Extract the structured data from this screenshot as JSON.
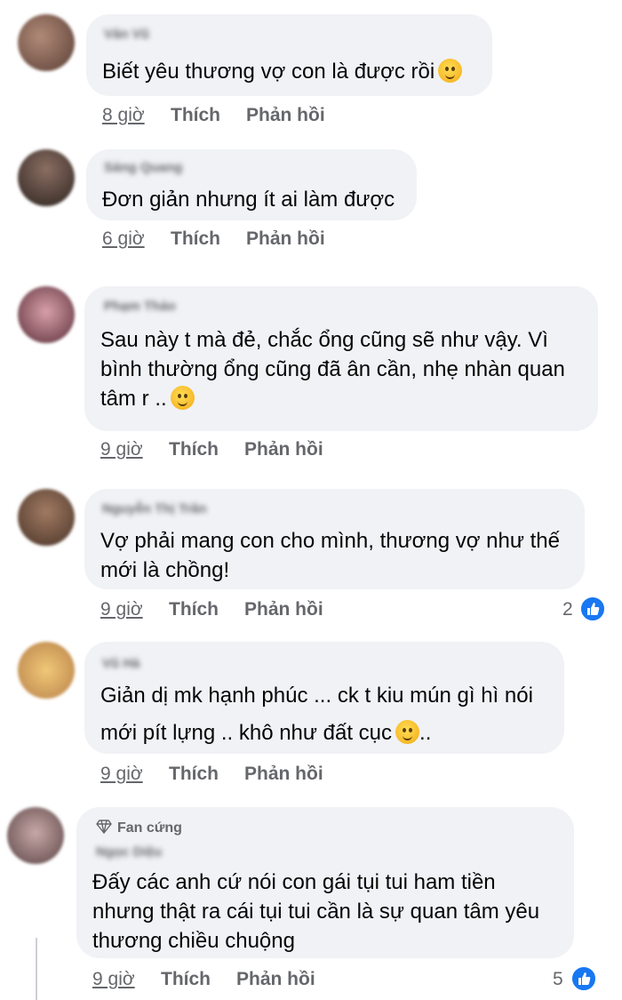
{
  "comments": [
    {
      "author": "Văn Vũ",
      "lines": [
        "Biết yêu thương vợ con là được rồi"
      ],
      "emoji": "crying-face-emoji",
      "time": "8 giờ",
      "like_label": "Thích",
      "reply_label": "Phản hồi",
      "avatar_color": "#7a5a4a"
    },
    {
      "author": "Sáng Quang",
      "lines": [
        "Đơn giản nhưng ít ai làm được"
      ],
      "time": "6 giờ",
      "like_label": "Thích",
      "reply_label": "Phản hồi",
      "avatar_color": "#4a3c36"
    },
    {
      "author": "Phạm Thảo",
      "lines": [
        "Sau này t mà đẻ, chắc ổng cũng sẽ như vậy. Vì",
        "bình thường ổng cũng đã ân cần, nhẹ nhàn quan",
        "tâm r .."
      ],
      "emoji": "zany-face-emoji",
      "time": "9 giờ",
      "like_label": "Thích",
      "reply_label": "Phản hồi",
      "avatar_color": "#8a4a5a"
    },
    {
      "author": "Nguyễn Thị Trân",
      "lines": [
        "Vợ phải mang con cho mình, thương vợ như thế",
        "mới là chồng!"
      ],
      "time": "9 giờ",
      "like_label": "Thích",
      "reply_label": "Phản hồi",
      "like_count": "2",
      "avatar_color": "#6b5040"
    },
    {
      "author": "Vũ Hà",
      "lines": [
        "Giản dị mk hạnh phúc ... ck t kiu mún gì hì nói",
        "mới pít lựng .. khô như đất cục"
      ],
      "emoji": "rolling-laughing-emoji",
      "trailing": "..",
      "time": "9 giờ",
      "like_label": "Thích",
      "reply_label": "Phản hồi",
      "avatar_color": "#c89050"
    },
    {
      "badge": "Fan cứng",
      "author": "Ngọc Diệu",
      "lines": [
        "Đấy các anh cứ nói con gái tụi tui ham tiền",
        "nhưng thật ra cái tụi tui cần là sự quan tâm yêu",
        "thương chiều chuộng"
      ],
      "time": "9 giờ",
      "like_label": "Thích",
      "reply_label": "Phản hồi",
      "like_count": "5",
      "avatar_color": "#8a7070"
    }
  ],
  "colors": {
    "bubble": "#f0f2f5",
    "meta": "#65676b",
    "text": "#050505",
    "like_blue": "#1877f2"
  }
}
